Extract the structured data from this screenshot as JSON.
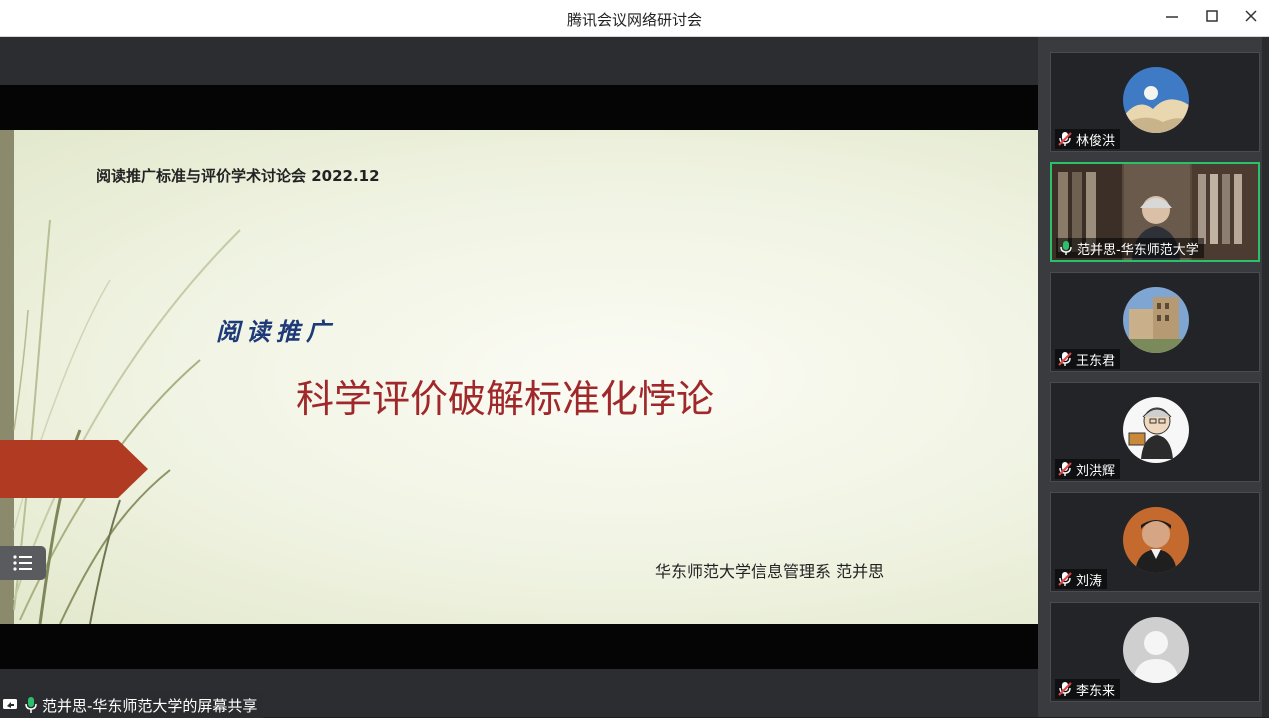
{
  "window": {
    "title": "腾讯会议网络研讨会",
    "minimize_icon": "minimize-icon",
    "maximize_icon": "maximize-icon",
    "close_icon": "close-icon"
  },
  "slide": {
    "meeting_line": "阅读推广标准与评价学术讨论会 2022.12",
    "subtitle": "阅读推广",
    "title": "科学评价破解标准化悖论",
    "author": "华东师范大学信息管理系  范并思",
    "accent_color": "#b03a22"
  },
  "share_status": {
    "label": "范并思-华东师范大学的屏幕共享"
  },
  "participants": [
    {
      "name": "林俊洪",
      "mic": "muted",
      "active": false,
      "avatar": "moon-landscape"
    },
    {
      "name": "范并思-华东师范大学",
      "mic": "on",
      "active": true,
      "avatar": "video"
    },
    {
      "name": "王东君",
      "mic": "muted",
      "active": false,
      "avatar": "building"
    },
    {
      "name": "刘洪辉",
      "mic": "muted",
      "active": false,
      "avatar": "cartoon"
    },
    {
      "name": "刘涛",
      "mic": "muted",
      "active": false,
      "avatar": "photo"
    },
    {
      "name": "李东来",
      "mic": "muted",
      "active": false,
      "avatar": "default-person"
    }
  ],
  "colors": {
    "active_border": "#2bc06a",
    "mic_on": "#2bc06a",
    "mic_muted": "#e04444"
  }
}
